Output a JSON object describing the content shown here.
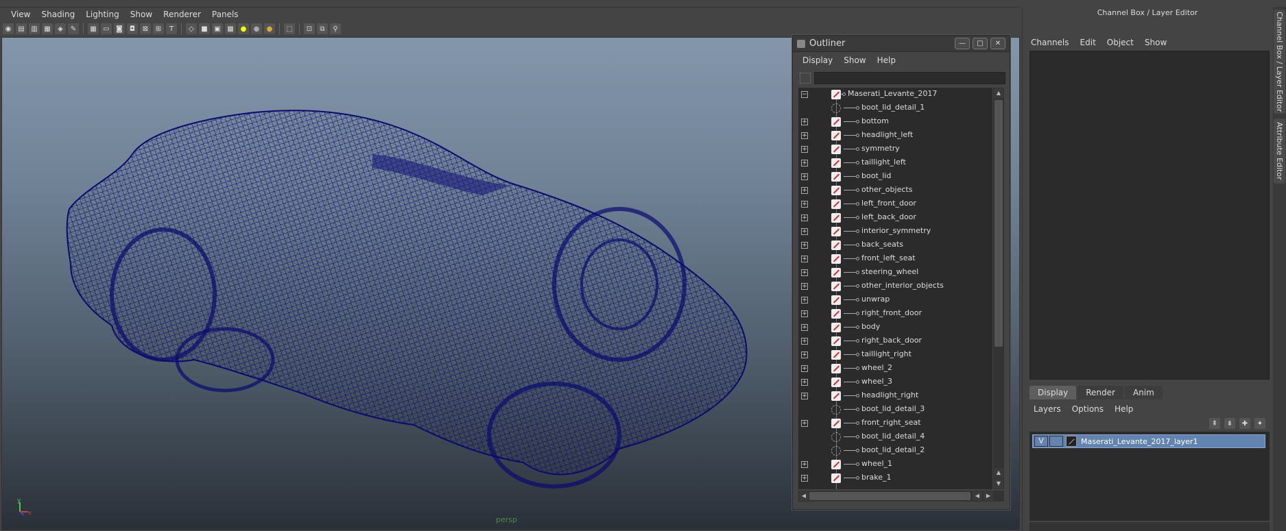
{
  "viewport": {
    "menu": [
      "View",
      "Shading",
      "Lighting",
      "Show",
      "Renderer",
      "Panels"
    ],
    "camera_label": "persp",
    "model_color": "#0a0a6e"
  },
  "outliner": {
    "title": "Outliner",
    "menu": [
      "Display",
      "Show",
      "Help"
    ],
    "filter_placeholder": "",
    "root": "Maserati_Levante_2017",
    "items": [
      {
        "label": "boot_lid_detail_1",
        "expandable": false,
        "icon": "group"
      },
      {
        "label": "bottom",
        "expandable": true,
        "icon": "mesh"
      },
      {
        "label": "headlight_left",
        "expandable": true,
        "icon": "mesh"
      },
      {
        "label": "symmetry",
        "expandable": true,
        "icon": "mesh"
      },
      {
        "label": "taillight_left",
        "expandable": true,
        "icon": "mesh"
      },
      {
        "label": "boot_lid",
        "expandable": true,
        "icon": "mesh"
      },
      {
        "label": "other_objects",
        "expandable": true,
        "icon": "mesh"
      },
      {
        "label": "left_front_door",
        "expandable": true,
        "icon": "mesh"
      },
      {
        "label": "left_back_door",
        "expandable": true,
        "icon": "mesh"
      },
      {
        "label": "interior_symmetry",
        "expandable": true,
        "icon": "mesh"
      },
      {
        "label": "back_seats",
        "expandable": true,
        "icon": "mesh"
      },
      {
        "label": "front_left_seat",
        "expandable": true,
        "icon": "mesh"
      },
      {
        "label": "steering_wheel",
        "expandable": true,
        "icon": "mesh"
      },
      {
        "label": "other_interior_objects",
        "expandable": true,
        "icon": "mesh"
      },
      {
        "label": "unwrap",
        "expandable": true,
        "icon": "mesh"
      },
      {
        "label": "right_front_door",
        "expandable": true,
        "icon": "mesh"
      },
      {
        "label": "body",
        "expandable": true,
        "icon": "mesh"
      },
      {
        "label": "right_back_door",
        "expandable": true,
        "icon": "mesh"
      },
      {
        "label": "taillight_right",
        "expandable": true,
        "icon": "mesh"
      },
      {
        "label": "wheel_2",
        "expandable": true,
        "icon": "mesh"
      },
      {
        "label": "wheel_3",
        "expandable": true,
        "icon": "mesh"
      },
      {
        "label": "headlight_right",
        "expandable": true,
        "icon": "mesh"
      },
      {
        "label": "boot_lid_detail_3",
        "expandable": false,
        "icon": "group"
      },
      {
        "label": "front_right_seat",
        "expandable": true,
        "icon": "mesh"
      },
      {
        "label": "boot_lid_detail_4",
        "expandable": false,
        "icon": "group"
      },
      {
        "label": "boot_lid_detail_2",
        "expandable": false,
        "icon": "group"
      },
      {
        "label": "wheel_1",
        "expandable": true,
        "icon": "mesh"
      },
      {
        "label": "brake_1",
        "expandable": true,
        "icon": "mesh"
      }
    ]
  },
  "channelbox": {
    "title": "Channel Box / Layer Editor",
    "menu": [
      "Channels",
      "Edit",
      "Object",
      "Show"
    ],
    "tabs": [
      "Display",
      "Render",
      "Anim"
    ],
    "layer_menu": [
      "Layers",
      "Options",
      "Help"
    ],
    "layer": {
      "visibility": "V",
      "name": "Maserati_Levante_2017_layer1"
    }
  },
  "side_tabs": [
    "Channel Box / Layer Editor",
    "Attribute Editor"
  ]
}
